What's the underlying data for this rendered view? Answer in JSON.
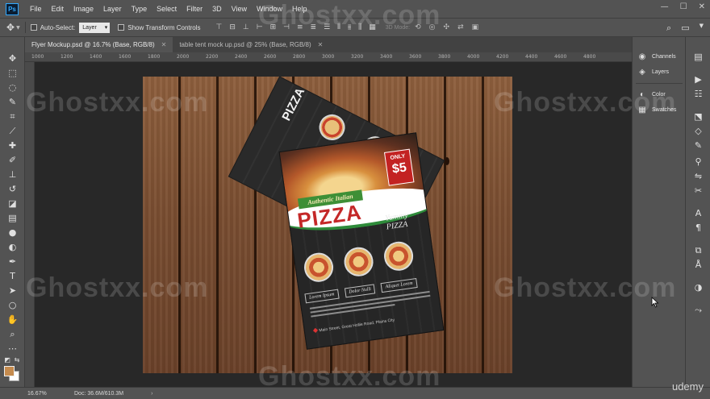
{
  "app": {
    "logo": "Ps",
    "menu": [
      "File",
      "Edit",
      "Image",
      "Layer",
      "Type",
      "Select",
      "Filter",
      "3D",
      "View",
      "Window",
      "Help"
    ],
    "window_controls": [
      "—",
      "☐",
      "✕"
    ]
  },
  "options_bar": {
    "auto_select_label": "Auto-Select:",
    "auto_select_target": "Layer",
    "transform_label": "Show Transform Controls",
    "mode3d_label": "3D Mode:"
  },
  "tabs": [
    {
      "label": "Flyer Mockup.psd @ 16.7% (Base, RGB/8)",
      "active": true
    },
    {
      "label": "table tent mock up.psd @ 25% (Base, RGB/8)",
      "active": false
    }
  ],
  "ruler_ticks": [
    "1000",
    "1200",
    "1400",
    "1600",
    "1800",
    "2000",
    "2200",
    "2400",
    "2600",
    "2800",
    "3000",
    "3200",
    "3400",
    "3600",
    "3800",
    "4000",
    "4200",
    "4400",
    "4600",
    "4800"
  ],
  "panels": [
    {
      "label": "Channels",
      "icon": "channels-icon"
    },
    {
      "label": "Layers",
      "icon": "layers-icon"
    },
    {
      "label": "Color",
      "icon": "color-icon"
    },
    {
      "label": "Swatches",
      "icon": "swatches-icon"
    }
  ],
  "flyer": {
    "back_title": "PIZZA",
    "ribbon": "Authentic Italian",
    "title": "PIZZA",
    "price_prefix": "ONLY",
    "price": "$5",
    "tagline": "Yummy PIZZA",
    "labels": [
      "Lorem Ipsum",
      "Dolor Nulli",
      "Aliquet Lorem"
    ],
    "address": "Main Street, Great Hollie Road, Plains City"
  },
  "colors": {
    "foreground": "#c58b4e",
    "background": "#ffffff",
    "accent_red": "#c42828",
    "accent_green": "#3e8f36"
  },
  "status": {
    "zoom": "16.67%",
    "doc": "Doc: 36.6M/610.3M"
  },
  "watermark": "Ghostxx.com",
  "brand": "udemy"
}
